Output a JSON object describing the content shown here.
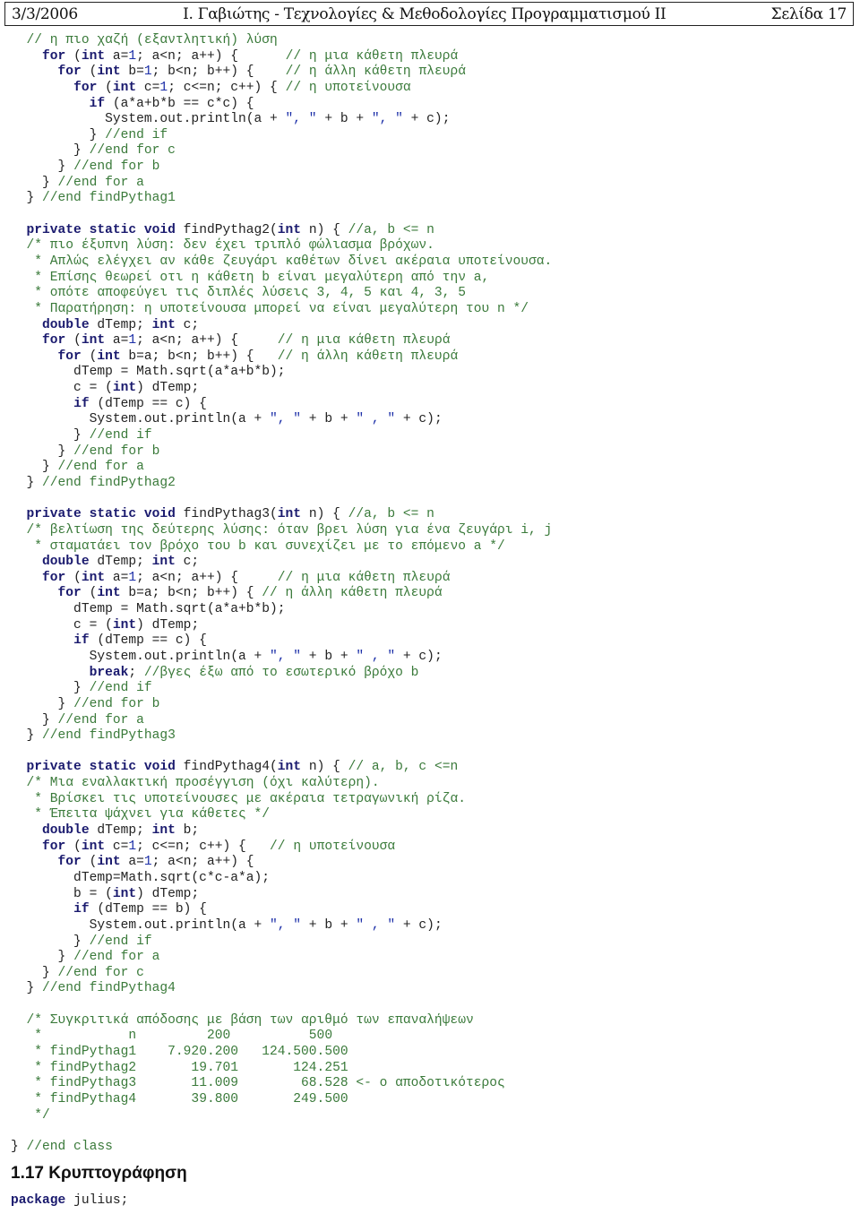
{
  "header": {
    "date": "3/3/2006",
    "title": "Ι. Γαβιώτης - Τεχνολογίες & Μεθοδολογίες Προγραμματισμού ΙΙ",
    "page": "Σελίδα 17"
  },
  "code_lines": [
    [
      [
        "  ",
        ""
      ],
      [
        "// η πιο χαζή (εξαντλητική) λύση",
        "cm"
      ]
    ],
    [
      [
        "    ",
        ""
      ],
      [
        "for",
        "kw"
      ],
      [
        " (",
        ""
      ],
      [
        "int",
        "kw"
      ],
      [
        " a=",
        ""
      ],
      [
        "1",
        "nu"
      ],
      [
        "; a<n; a++) {      ",
        ""
      ],
      [
        "// η μια κάθετη πλευρά",
        "cm"
      ]
    ],
    [
      [
        "      ",
        ""
      ],
      [
        "for",
        "kw"
      ],
      [
        " (",
        ""
      ],
      [
        "int",
        "kw"
      ],
      [
        " b=",
        ""
      ],
      [
        "1",
        "nu"
      ],
      [
        "; b<n; b++) {    ",
        ""
      ],
      [
        "// η άλλη κάθετη πλευρά",
        "cm"
      ]
    ],
    [
      [
        "        ",
        ""
      ],
      [
        "for",
        "kw"
      ],
      [
        " (",
        ""
      ],
      [
        "int",
        "kw"
      ],
      [
        " c=",
        ""
      ],
      [
        "1",
        "nu"
      ],
      [
        "; c<=n; c++) { ",
        ""
      ],
      [
        "// η υποτείνουσα",
        "cm"
      ]
    ],
    [
      [
        "          ",
        ""
      ],
      [
        "if",
        "kw"
      ],
      [
        " (a*a+b*b == c*c) {",
        ""
      ]
    ],
    [
      [
        "            System.out.println(a + ",
        ""
      ],
      [
        "\", \"",
        "st"
      ],
      [
        " + b + ",
        ""
      ],
      [
        "\", \"",
        "st"
      ],
      [
        " + c);",
        ""
      ]
    ],
    [
      [
        "          } ",
        ""
      ],
      [
        "//end if",
        "cm"
      ]
    ],
    [
      [
        "        } ",
        ""
      ],
      [
        "//end for c",
        "cm"
      ]
    ],
    [
      [
        "      } ",
        ""
      ],
      [
        "//end for b",
        "cm"
      ]
    ],
    [
      [
        "    } ",
        ""
      ],
      [
        "//end for a",
        "cm"
      ]
    ],
    [
      [
        "  } ",
        ""
      ],
      [
        "//end findPythag1",
        "cm"
      ]
    ],
    [
      [
        "",
        ""
      ]
    ],
    [
      [
        "  ",
        ""
      ],
      [
        "private static void",
        "kw"
      ],
      [
        " findPythag2(",
        ""
      ],
      [
        "int",
        "kw"
      ],
      [
        " n) { ",
        ""
      ],
      [
        "//a, b <= n",
        "cm"
      ]
    ],
    [
      [
        "  ",
        ""
      ],
      [
        "/* πιο έξυπνη λύση: δεν έχει τριπλό φώλιασμα βρόχων.",
        "cm"
      ]
    ],
    [
      [
        "   ",
        ""
      ],
      [
        "* Απλώς ελέγχει αν κάθε ζευγάρι καθέτων δίνει ακέραια υποτείνουσα.",
        "cm"
      ]
    ],
    [
      [
        "   ",
        ""
      ],
      [
        "* Επίσης θεωρεί οτι η κάθετη b είναι μεγαλύτερη από την a,",
        "cm"
      ]
    ],
    [
      [
        "   ",
        ""
      ],
      [
        "* οπότε αποφεύγει τις διπλές λύσεις 3, 4, 5 και 4, 3, 5",
        "cm"
      ]
    ],
    [
      [
        "   ",
        ""
      ],
      [
        "* Παρατήρηση: η υποτείνουσα μπορεί να είναι μεγαλύτερη του n */",
        "cm"
      ]
    ],
    [
      [
        "    ",
        ""
      ],
      [
        "double",
        "kw"
      ],
      [
        " dTemp; ",
        ""
      ],
      [
        "int",
        "kw"
      ],
      [
        " c;",
        ""
      ]
    ],
    [
      [
        "    ",
        ""
      ],
      [
        "for",
        "kw"
      ],
      [
        " (",
        ""
      ],
      [
        "int",
        "kw"
      ],
      [
        " a=",
        ""
      ],
      [
        "1",
        "nu"
      ],
      [
        "; a<n; a++) {     ",
        ""
      ],
      [
        "// η μια κάθετη πλευρά",
        "cm"
      ]
    ],
    [
      [
        "      ",
        ""
      ],
      [
        "for",
        "kw"
      ],
      [
        " (",
        ""
      ],
      [
        "int",
        "kw"
      ],
      [
        " b=a; b<n; b++) {   ",
        ""
      ],
      [
        "// η άλλη κάθετη πλευρά",
        "cm"
      ]
    ],
    [
      [
        "        dTemp = Math.sqrt(a*a+b*b);",
        ""
      ]
    ],
    [
      [
        "        c = (",
        ""
      ],
      [
        "int",
        "kw"
      ],
      [
        ") dTemp;",
        ""
      ]
    ],
    [
      [
        "        ",
        ""
      ],
      [
        "if",
        "kw"
      ],
      [
        " (dTemp == c) {",
        ""
      ]
    ],
    [
      [
        "          System.out.println(a + ",
        ""
      ],
      [
        "\", \"",
        "st"
      ],
      [
        " + b + ",
        ""
      ],
      [
        "\" , \"",
        "st"
      ],
      [
        " + c);",
        ""
      ]
    ],
    [
      [
        "        } ",
        ""
      ],
      [
        "//end if",
        "cm"
      ]
    ],
    [
      [
        "      } ",
        ""
      ],
      [
        "//end for b",
        "cm"
      ]
    ],
    [
      [
        "    } ",
        ""
      ],
      [
        "//end for a",
        "cm"
      ]
    ],
    [
      [
        "  } ",
        ""
      ],
      [
        "//end findPythag2",
        "cm"
      ]
    ],
    [
      [
        "",
        ""
      ]
    ],
    [
      [
        "  ",
        ""
      ],
      [
        "private static void",
        "kw"
      ],
      [
        " findPythag3(",
        ""
      ],
      [
        "int",
        "kw"
      ],
      [
        " n) { ",
        ""
      ],
      [
        "//a, b <= n",
        "cm"
      ]
    ],
    [
      [
        "  ",
        ""
      ],
      [
        "/* βελτίωση της δεύτερης λύσης: όταν βρει λύση για ένα ζευγάρι i, j",
        "cm"
      ]
    ],
    [
      [
        "   ",
        ""
      ],
      [
        "* σταματάει τον βρόχο του b και συνεχίζει με το επόμενο a */",
        "cm"
      ]
    ],
    [
      [
        "    ",
        ""
      ],
      [
        "double",
        "kw"
      ],
      [
        " dTemp; ",
        ""
      ],
      [
        "int",
        "kw"
      ],
      [
        " c;",
        ""
      ]
    ],
    [
      [
        "    ",
        ""
      ],
      [
        "for",
        "kw"
      ],
      [
        " (",
        ""
      ],
      [
        "int",
        "kw"
      ],
      [
        " a=",
        ""
      ],
      [
        "1",
        "nu"
      ],
      [
        "; a<n; a++) {     ",
        ""
      ],
      [
        "// η μια κάθετη πλευρά",
        "cm"
      ]
    ],
    [
      [
        "      ",
        ""
      ],
      [
        "for",
        "kw"
      ],
      [
        " (",
        ""
      ],
      [
        "int",
        "kw"
      ],
      [
        " b=a; b<n; b++) { ",
        ""
      ],
      [
        "// η άλλη κάθετη πλευρά",
        "cm"
      ]
    ],
    [
      [
        "        dTemp = Math.sqrt(a*a+b*b);",
        ""
      ]
    ],
    [
      [
        "        c = (",
        ""
      ],
      [
        "int",
        "kw"
      ],
      [
        ") dTemp;",
        ""
      ]
    ],
    [
      [
        "        ",
        ""
      ],
      [
        "if",
        "kw"
      ],
      [
        " (dTemp == c) {",
        ""
      ]
    ],
    [
      [
        "          System.out.println(a + ",
        ""
      ],
      [
        "\", \"",
        "st"
      ],
      [
        " + b + ",
        ""
      ],
      [
        "\" , \"",
        "st"
      ],
      [
        " + c);",
        ""
      ]
    ],
    [
      [
        "          ",
        ""
      ],
      [
        "break",
        "kw"
      ],
      [
        "; ",
        ""
      ],
      [
        "//βγες έξω από το εσωτερικό βρόχο b",
        "cm"
      ]
    ],
    [
      [
        "        } ",
        ""
      ],
      [
        "//end if",
        "cm"
      ]
    ],
    [
      [
        "      } ",
        ""
      ],
      [
        "//end for b",
        "cm"
      ]
    ],
    [
      [
        "    } ",
        ""
      ],
      [
        "//end for a",
        "cm"
      ]
    ],
    [
      [
        "  } ",
        ""
      ],
      [
        "//end findPythag3",
        "cm"
      ]
    ],
    [
      [
        "",
        ""
      ]
    ],
    [
      [
        "  ",
        ""
      ],
      [
        "private static void",
        "kw"
      ],
      [
        " findPythag4(",
        ""
      ],
      [
        "int",
        "kw"
      ],
      [
        " n) { ",
        ""
      ],
      [
        "// a, b, c <=n",
        "cm"
      ]
    ],
    [
      [
        "  ",
        ""
      ],
      [
        "/* Μια εναλλακτική προσέγγιση (όχι καλύτερη).",
        "cm"
      ]
    ],
    [
      [
        "   ",
        ""
      ],
      [
        "* Βρίσκει τις υποτείνουσες με ακέραια τετραγωνική ρίζα.",
        "cm"
      ]
    ],
    [
      [
        "   ",
        ""
      ],
      [
        "* Έπειτα ψάχνει για κάθετες */",
        "cm"
      ]
    ],
    [
      [
        "    ",
        ""
      ],
      [
        "double",
        "kw"
      ],
      [
        " dTemp; ",
        ""
      ],
      [
        "int",
        "kw"
      ],
      [
        " b;",
        ""
      ]
    ],
    [
      [
        "    ",
        ""
      ],
      [
        "for",
        "kw"
      ],
      [
        " (",
        ""
      ],
      [
        "int",
        "kw"
      ],
      [
        " c=",
        ""
      ],
      [
        "1",
        "nu"
      ],
      [
        "; c<=n; c++) {   ",
        ""
      ],
      [
        "// η υποτείνουσα",
        "cm"
      ]
    ],
    [
      [
        "      ",
        ""
      ],
      [
        "for",
        "kw"
      ],
      [
        " (",
        ""
      ],
      [
        "int",
        "kw"
      ],
      [
        " a=",
        ""
      ],
      [
        "1",
        "nu"
      ],
      [
        "; a<n; a++) {",
        ""
      ]
    ],
    [
      [
        "        dTemp=Math.sqrt(c*c-a*a);",
        ""
      ]
    ],
    [
      [
        "        b = (",
        ""
      ],
      [
        "int",
        "kw"
      ],
      [
        ") dTemp;",
        ""
      ]
    ],
    [
      [
        "        ",
        ""
      ],
      [
        "if",
        "kw"
      ],
      [
        " (dTemp == b) {",
        ""
      ]
    ],
    [
      [
        "          System.out.println(a + ",
        ""
      ],
      [
        "\", \"",
        "st"
      ],
      [
        " + b + ",
        ""
      ],
      [
        "\" , \"",
        "st"
      ],
      [
        " + c);",
        ""
      ]
    ],
    [
      [
        "        } ",
        ""
      ],
      [
        "//end if",
        "cm"
      ]
    ],
    [
      [
        "      } ",
        ""
      ],
      [
        "//end for a",
        "cm"
      ]
    ],
    [
      [
        "    } ",
        ""
      ],
      [
        "//end for c",
        "cm"
      ]
    ],
    [
      [
        "  } ",
        ""
      ],
      [
        "//end findPythag4",
        "cm"
      ]
    ],
    [
      [
        "",
        ""
      ]
    ],
    [
      [
        "  ",
        ""
      ],
      [
        "/* Συγκριτικά απόδοσης με βάση των αριθμό των επαναλήψεων",
        "cm"
      ]
    ],
    [
      [
        "   ",
        ""
      ],
      [
        "*           n         200          500",
        "cm"
      ]
    ],
    [
      [
        "   ",
        ""
      ],
      [
        "* findPythag1    7.920.200   124.500.500",
        "cm"
      ]
    ],
    [
      [
        "   ",
        ""
      ],
      [
        "* findPythag2       19.701       124.251",
        "cm"
      ]
    ],
    [
      [
        "   ",
        ""
      ],
      [
        "* findPythag3       11.009        68.528 <- ο αποδοτικότερος",
        "cm"
      ]
    ],
    [
      [
        "   ",
        ""
      ],
      [
        "* findPythag4       39.800       249.500",
        "cm"
      ]
    ],
    [
      [
        "   ",
        ""
      ],
      [
        "*/",
        "cm"
      ]
    ],
    [
      [
        "",
        ""
      ]
    ],
    [
      [
        "} ",
        ""
      ],
      [
        "//end class",
        "cm"
      ]
    ]
  ],
  "comparison_table": {
    "columns": [
      "n",
      "200",
      "500"
    ],
    "rows": [
      {
        "method": "findPythag1",
        "n200": "7.920.200",
        "n500": "124.500.500"
      },
      {
        "method": "findPythag2",
        "n200": "19.701",
        "n500": "124.251"
      },
      {
        "method": "findPythag3",
        "n200": "11.009",
        "n500": "68.528",
        "note": "<- ο αποδοτικότερος"
      },
      {
        "method": "findPythag4",
        "n200": "39.800",
        "n500": "249.500"
      }
    ]
  },
  "section_heading": "1.17  Κρυπτογράφηση",
  "package_line": [
    [
      "package",
      "kw"
    ],
    [
      " julius;",
      ""
    ]
  ]
}
